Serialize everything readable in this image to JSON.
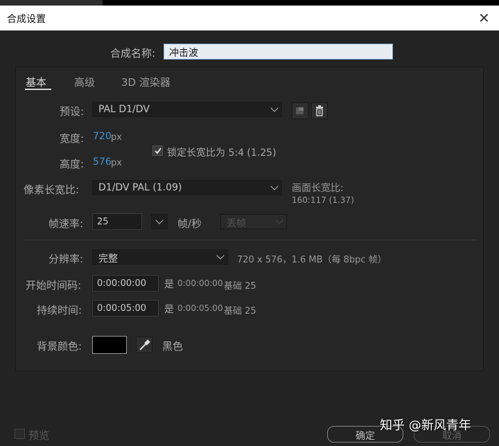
{
  "window": {
    "title": "合成设置",
    "close_glyph": "✕"
  },
  "comp_name": {
    "label": "合成名称:",
    "value": "冲击波"
  },
  "tabs": [
    {
      "label": "基本"
    },
    {
      "label": "高级"
    },
    {
      "label": "3D 渲染器"
    }
  ],
  "preset": {
    "label": "预设:",
    "value": "PAL D1/DV"
  },
  "width": {
    "label": "宽度:",
    "value": "720",
    "unit": "px"
  },
  "height": {
    "label": "高度:",
    "value": "576",
    "unit": "px"
  },
  "lock_aspect": {
    "label": "锁定长宽比为 5:4 (1.25)",
    "checked": true
  },
  "pixel_aspect": {
    "label": "像素长宽比:",
    "value": "D1/DV PAL (1.09)"
  },
  "frame_aspect": {
    "label": "画面长宽比:",
    "value": "160:117 (1.37)"
  },
  "frame_rate": {
    "label": "帧速率:",
    "value": "25",
    "unit": "帧/秒",
    "drop_frame": "丢帧"
  },
  "resolution": {
    "label": "分辨率:",
    "value": "完整",
    "info": "720 x 576，1.6 MB（每 8bpc 帧）"
  },
  "start_timecode": {
    "label": "开始时间码:",
    "value": "0:00:00:00",
    "eq": "是",
    "eq_value": "0:00:00:00",
    "base": "基础 25"
  },
  "duration": {
    "label": "持续时间:",
    "value": "0:00:05:00",
    "eq": "是",
    "eq_value": "0:00:05:00",
    "base": "基础 25"
  },
  "background_color": {
    "label": "背景颜色:",
    "name": "黑色",
    "swatch": "#000000"
  },
  "footer": {
    "preview_label": "预览",
    "ok_label": "确定",
    "cancel_label": "取消",
    "watermark": "知乎 @新风青年"
  }
}
